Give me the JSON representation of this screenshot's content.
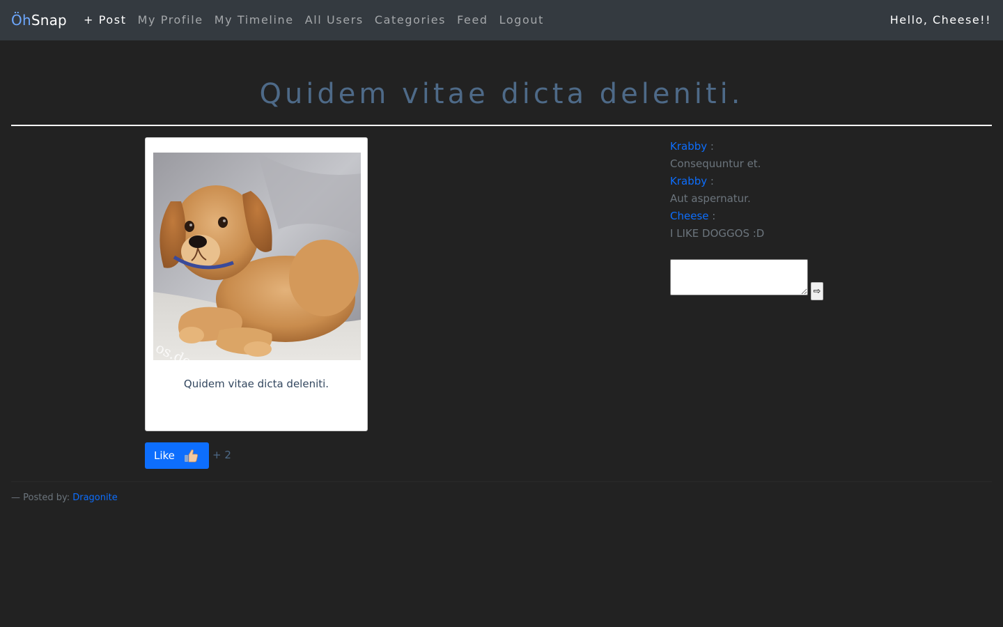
{
  "navbar": {
    "brand_part1": "Öh",
    "brand_part2": "Snap",
    "items": [
      {
        "label": "+ Post"
      },
      {
        "label": "My Profile"
      },
      {
        "label": "My Timeline"
      },
      {
        "label": "All Users"
      },
      {
        "label": "Categories"
      },
      {
        "label": "Feed"
      },
      {
        "label": "Logout"
      }
    ],
    "greeting": "Hello, Cheese!!"
  },
  "post": {
    "title": "Quidem vitae dicta deleniti.",
    "caption": "Quidem vitae dicta deleniti.",
    "image_icon": "puppy-photo",
    "like_label": "Like",
    "like_icon": "thumbs-up-icon",
    "like_count": "+ 2",
    "posted_by_prefix": "— Posted by: ",
    "posted_by_user": "Dragonite"
  },
  "comments": [
    {
      "author": "Krabby",
      "separator": " :",
      "text": "Consequuntur et."
    },
    {
      "author": "Krabby",
      "separator": " :",
      "text": "Aut aspernatur."
    },
    {
      "author": "Cheese",
      "separator": " :",
      "text": "I LIKE DOGGOS :D"
    }
  ],
  "comment_form": {
    "placeholder": "",
    "submit_icon": "arrow-right-icon",
    "submit_glyph": "⇨"
  }
}
